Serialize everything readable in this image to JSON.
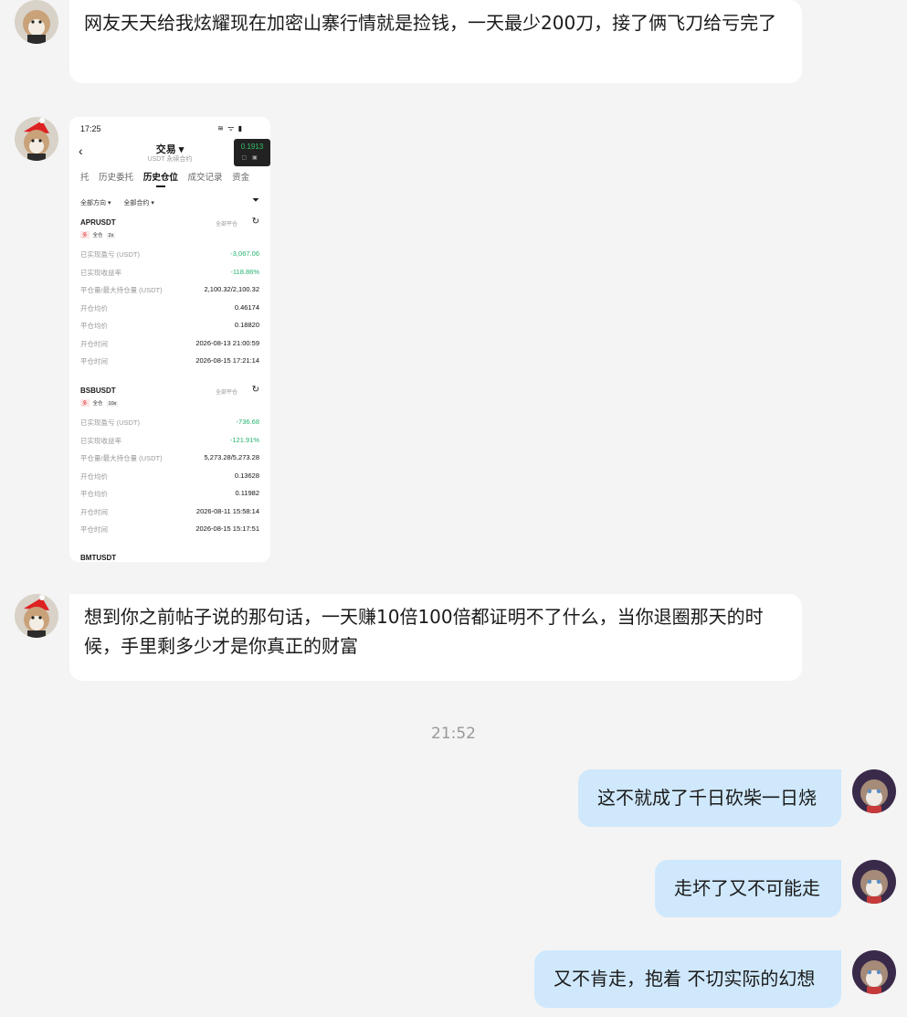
{
  "messages": [
    {
      "text": "网友天天给我炫耀现在加密山寨行情就是捡钱，一天最少200刀，接了俩飞刀给亏完了"
    },
    {
      "text": "想到你之前帖子说的那句话，一天赚10倍100倍都证明不了什么，当你退圈那天的时候，手里剩多少才是你真正的财富"
    }
  ],
  "timestamp": "21:52",
  "my_messages": [
    {
      "text": "这不就成了千日砍柴一日烧"
    },
    {
      "text": "走坏了又不可能走"
    },
    {
      "text": "又不肯走，抱着 不切实际的幻想"
    }
  ],
  "screenshot": {
    "status_time": "17:25",
    "status_icons": "≋ ᯤ ▮",
    "back": "‹",
    "title": "交易 ▾",
    "subtitle": "USDT 永续合约",
    "mini_price": "0.1913",
    "tabs": [
      "托",
      "历史委托",
      "历史仓位",
      "成交记录",
      "资金"
    ],
    "filters": [
      "全部方向 ▾",
      "全部合约 ▾"
    ],
    "positions": [
      {
        "symbol": "APRUSDT",
        "close_label": "全部平仓",
        "tag": "多",
        "margin": "全仓",
        "leverage": "2x",
        "rows": [
          {
            "k": "已实现盈亏 (USDT)",
            "v": "-3,067.06",
            "green": true
          },
          {
            "k": "已实现收益率",
            "v": "-118.86%",
            "green": true
          },
          {
            "k": "平仓量/最大持仓量 (USDT)",
            "v": "2,100.32/2,100.32"
          },
          {
            "k": "开仓均价",
            "v": "0.46174"
          },
          {
            "k": "平仓均价",
            "v": "0.18820"
          },
          {
            "k": "开仓时间",
            "v": "2026-08-13 21:00:59"
          },
          {
            "k": "平仓时间",
            "v": "2026-08-15 17:21:14"
          }
        ]
      },
      {
        "symbol": "BSBUSDT",
        "close_label": "全部平仓",
        "tag": "多",
        "margin": "全仓",
        "leverage": "10x",
        "rows": [
          {
            "k": "已实现盈亏 (USDT)",
            "v": "-736.68",
            "green": true
          },
          {
            "k": "已实现收益率",
            "v": "-121.91%",
            "green": true
          },
          {
            "k": "平仓量/最大持仓量 (USDT)",
            "v": "5,273.28/5,273.28"
          },
          {
            "k": "开仓均价",
            "v": "0.13628"
          },
          {
            "k": "平仓均价",
            "v": "0.11982"
          },
          {
            "k": "开仓时间",
            "v": "2026-08-11 15:58:14"
          },
          {
            "k": "平仓时间",
            "v": "2026-08-15 15:17:51"
          }
        ]
      }
    ],
    "cut_symbol": "BMTUSDT"
  }
}
